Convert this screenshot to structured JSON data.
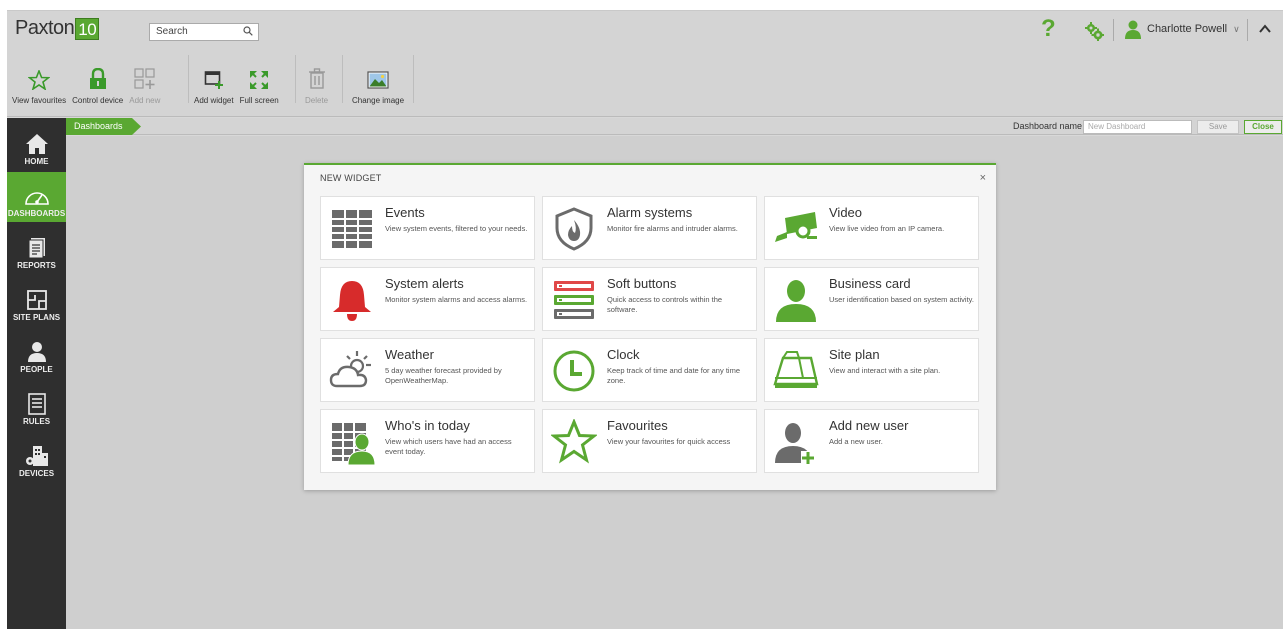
{
  "header": {
    "logo_text": "Paxton",
    "logo_number": "10",
    "search_placeholder": "Search",
    "help_label": "?",
    "user_name": "Charlotte Powell"
  },
  "toolbar": {
    "view_favourites": "View favourites",
    "control_device": "Control device",
    "add_new": "Add new",
    "add_widget": "Add widget",
    "full_screen": "Full screen",
    "delete": "Delete",
    "change_image": "Change image"
  },
  "sidebar": {
    "items": [
      {
        "label": "HOME"
      },
      {
        "label": "DASHBOARDS"
      },
      {
        "label": "REPORTS"
      },
      {
        "label": "SITE PLANS"
      },
      {
        "label": "PEOPLE"
      },
      {
        "label": "RULES"
      },
      {
        "label": "DEVICES"
      }
    ],
    "active_index": 1
  },
  "breadcrumb": {
    "current": "Dashboards",
    "dashboard_name_label": "Dashboard name",
    "dashboard_name_placeholder": "New Dashboard",
    "save_label": "Save",
    "close_label": "Close"
  },
  "modal": {
    "title": "NEW WIDGET",
    "close": "×",
    "widgets": [
      {
        "title": "Events",
        "desc": "View system events, filtered to your needs.",
        "icon": "events-table-icon"
      },
      {
        "title": "Alarm systems",
        "desc": "Monitor fire alarms and intruder alarms.",
        "icon": "alarm-shield-icon"
      },
      {
        "title": "Video",
        "desc": "View live video from an IP camera.",
        "icon": "camera-icon"
      },
      {
        "title": "System alerts",
        "desc": "Monitor system alarms and access alarms.",
        "icon": "bell-icon"
      },
      {
        "title": "Soft buttons",
        "desc": "Quick access to controls within the software.",
        "icon": "soft-buttons-icon"
      },
      {
        "title": "Business card",
        "desc": "User identification based on system activity.",
        "icon": "person-icon"
      },
      {
        "title": "Weather",
        "desc": "5 day weather forecast provided by OpenWeatherMap.",
        "icon": "weather-icon"
      },
      {
        "title": "Clock",
        "desc": "Keep track of time and date for any time zone.",
        "icon": "clock-icon"
      },
      {
        "title": "Site plan",
        "desc": "View and interact with a site plan.",
        "icon": "site-plan-icon"
      },
      {
        "title": "Who's in today",
        "desc": "View which users have had an access event today.",
        "icon": "whos-in-icon"
      },
      {
        "title": "Favourites",
        "desc": "View your favourites for quick access",
        "icon": "star-icon"
      },
      {
        "title": "Add new user",
        "desc": "Add a new user.",
        "icon": "add-user-icon"
      }
    ]
  },
  "colors": {
    "accent_green": "#5aa832",
    "alert_red": "#d72b2b",
    "icon_gray": "#6b6b6b",
    "sidebar_bg": "#2f2f2f"
  }
}
